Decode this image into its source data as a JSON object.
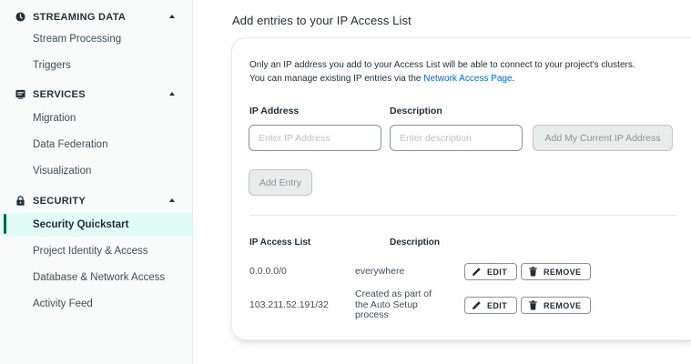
{
  "sidebar": {
    "sections": [
      {
        "label": "STREAMING DATA",
        "icon": "clock-icon"
      },
      {
        "label": "SERVICES",
        "icon": "services-icon"
      },
      {
        "label": "SECURITY",
        "icon": "lock-icon"
      }
    ],
    "items": [
      {
        "label": "Stream Processing"
      },
      {
        "label": "Triggers"
      },
      {
        "label": "Migration"
      },
      {
        "label": "Data Federation"
      },
      {
        "label": "Visualization"
      },
      {
        "label": "Security Quickstart",
        "active": true
      },
      {
        "label": "Project Identity & Access"
      },
      {
        "label": "Database & Network Access"
      },
      {
        "label": "Activity Feed"
      }
    ]
  },
  "main": {
    "title": "Add entries to your IP Access List",
    "intro_line1": "Only an IP address you add to your Access List will be able to connect to your project's clusters.",
    "intro_line2": "You can manage existing IP entries via the ",
    "intro_link": "Network Access Page",
    "intro_end": ".",
    "ip_label": "IP Address",
    "desc_label": "Description",
    "ip_placeholder": "Enter IP Address",
    "desc_placeholder": "Enter description",
    "add_current_ip": "Add My Current IP Address",
    "add_entry": "Add Entry",
    "list_header_ip": "IP Access List",
    "list_header_desc": "Description",
    "edit_label": "EDIT",
    "remove_label": "REMOVE",
    "entries": [
      {
        "ip": "0.0.0.0/0",
        "description": "everywhere"
      },
      {
        "ip": "103.211.52.191/32",
        "description": "Created as part of\nthe Auto Setup\nprocess"
      }
    ]
  },
  "colors": {
    "accent_green": "#00684a",
    "active_bg": "#e3fcf7",
    "link_blue": "#016bf8"
  }
}
